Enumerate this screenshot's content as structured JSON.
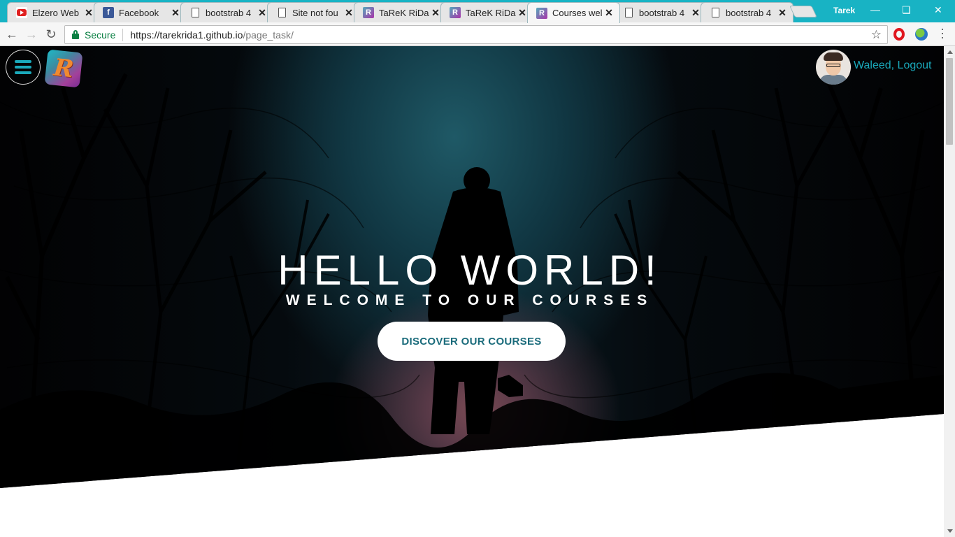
{
  "browser": {
    "tabs": [
      {
        "title": "Elzero Web",
        "icon": "youtube-icon"
      },
      {
        "title": "Facebook",
        "icon": "facebook-icon"
      },
      {
        "title": "bootstrab 4",
        "icon": "document-icon"
      },
      {
        "title": "Site not fou",
        "icon": "document-icon"
      },
      {
        "title": "TaReK RiDa",
        "icon": "tr-logo-icon"
      },
      {
        "title": "TaReK RiDa",
        "icon": "tr-logo-icon"
      },
      {
        "title": "Courses wel",
        "icon": "tr-logo-icon",
        "active": true
      },
      {
        "title": "bootstrab 4",
        "icon": "document-icon"
      },
      {
        "title": "bootstrab 4",
        "icon": "document-icon"
      }
    ],
    "close_glyph": "✕",
    "profile_name": "Tarek",
    "security_label": "Secure",
    "url_host": "https://tarekrida1.github.io",
    "url_path": "/page_task/",
    "accent_color": "#18b3c4"
  },
  "page": {
    "logo_letter": "R",
    "user_link": "Waleed, Logout",
    "hero_title": "HELLO WORLD!",
    "hero_subtitle": "WELCOME TO OUR COURSES",
    "cta_label": "DISCOVER OUR COURSES",
    "accent_color": "#1aa9bb"
  }
}
